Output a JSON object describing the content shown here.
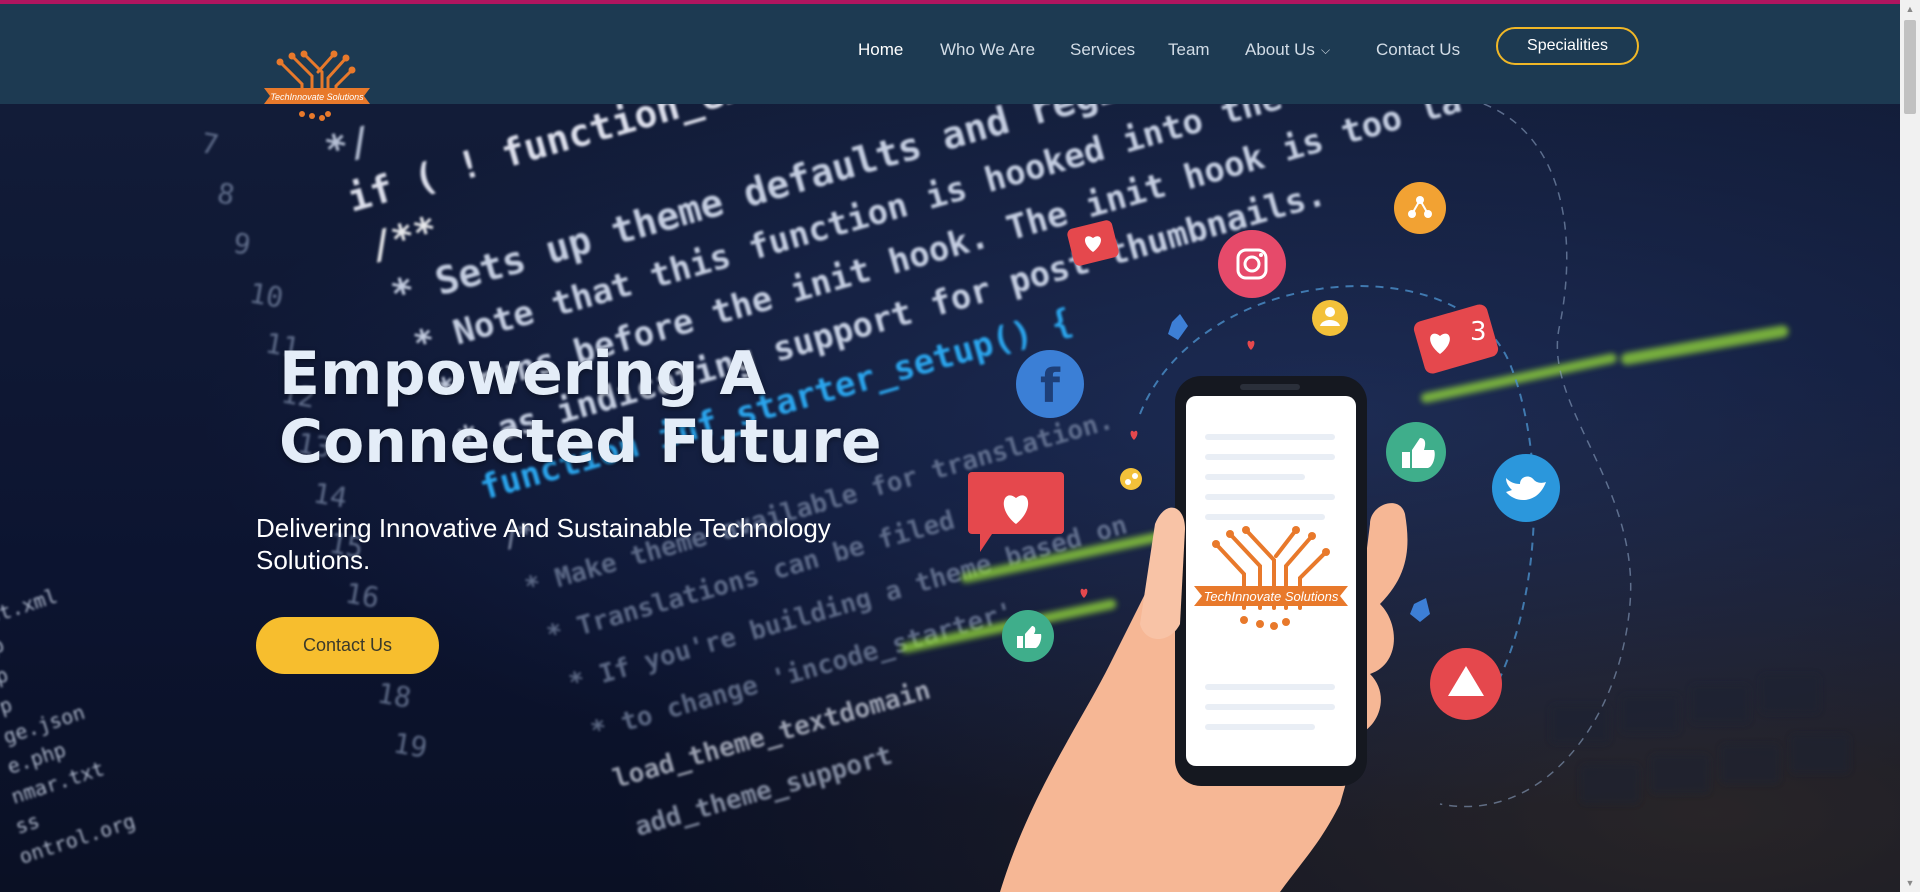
{
  "brand": {
    "name": "TechInnovate Solutions",
    "logo_color": "#e8792b"
  },
  "nav": {
    "items": [
      {
        "label": "Home",
        "active": true
      },
      {
        "label": "Who We Are"
      },
      {
        "label": "Services"
      },
      {
        "label": "Team"
      },
      {
        "label": "About Us",
        "has_dropdown": true,
        "icon": "chevron-down-icon"
      },
      {
        "label": "Contact Us"
      }
    ],
    "cta_label": "Specialities",
    "cta_border_color": "#f0b727"
  },
  "hero": {
    "title_line1": "Empowering A",
    "title_line2": "Connected Future",
    "subtitle": "Delivering Innovative And Sustainable Technology Solutions.",
    "cta_label": "Contact Us",
    "cta_color": "#f7be2e",
    "background_code": {
      "line_numbers": [
        "7",
        "8",
        "9",
        "10",
        "11",
        "12",
        "13",
        "14",
        "15",
        "16",
        "17",
        "18",
        "19"
      ],
      "lines": [
        "*/",
        "if ( ! function_exists(",
        "/**",
        "* Sets up theme defaults and regi",
        "* Note that this function is hooked into the",
        "* runs before the init hook. The init hook is too la",
        "* as indicating support for post thumbnails.",
        "function inf_starter_setup() {",
        "/*",
        "* Make theme available for translation.",
        "* Translations can be filed in the",
        "* If you're building a theme based on",
        "* to change 'incode_starter'",
        "load_theme_textdomain",
        "add_theme_support"
      ],
      "file_list": [
        "st.xml",
        "p",
        "p",
        "p",
        "ge.json",
        "e.php",
        "nmar.txt",
        "ss",
        "ontrol.org"
      ]
    },
    "social_icons": [
      "share-icon",
      "heart-bubble-icon",
      "instagram-icon",
      "user-icon",
      "like-3-icon",
      "thumb-like-icon",
      "facebook-icon",
      "thumbs-up-icon",
      "twitter-icon",
      "heart-bubble-icon",
      "share-icon",
      "thumbs-up-icon",
      "alert-icon",
      "like-hand-icon"
    ],
    "notification_count": "3"
  }
}
